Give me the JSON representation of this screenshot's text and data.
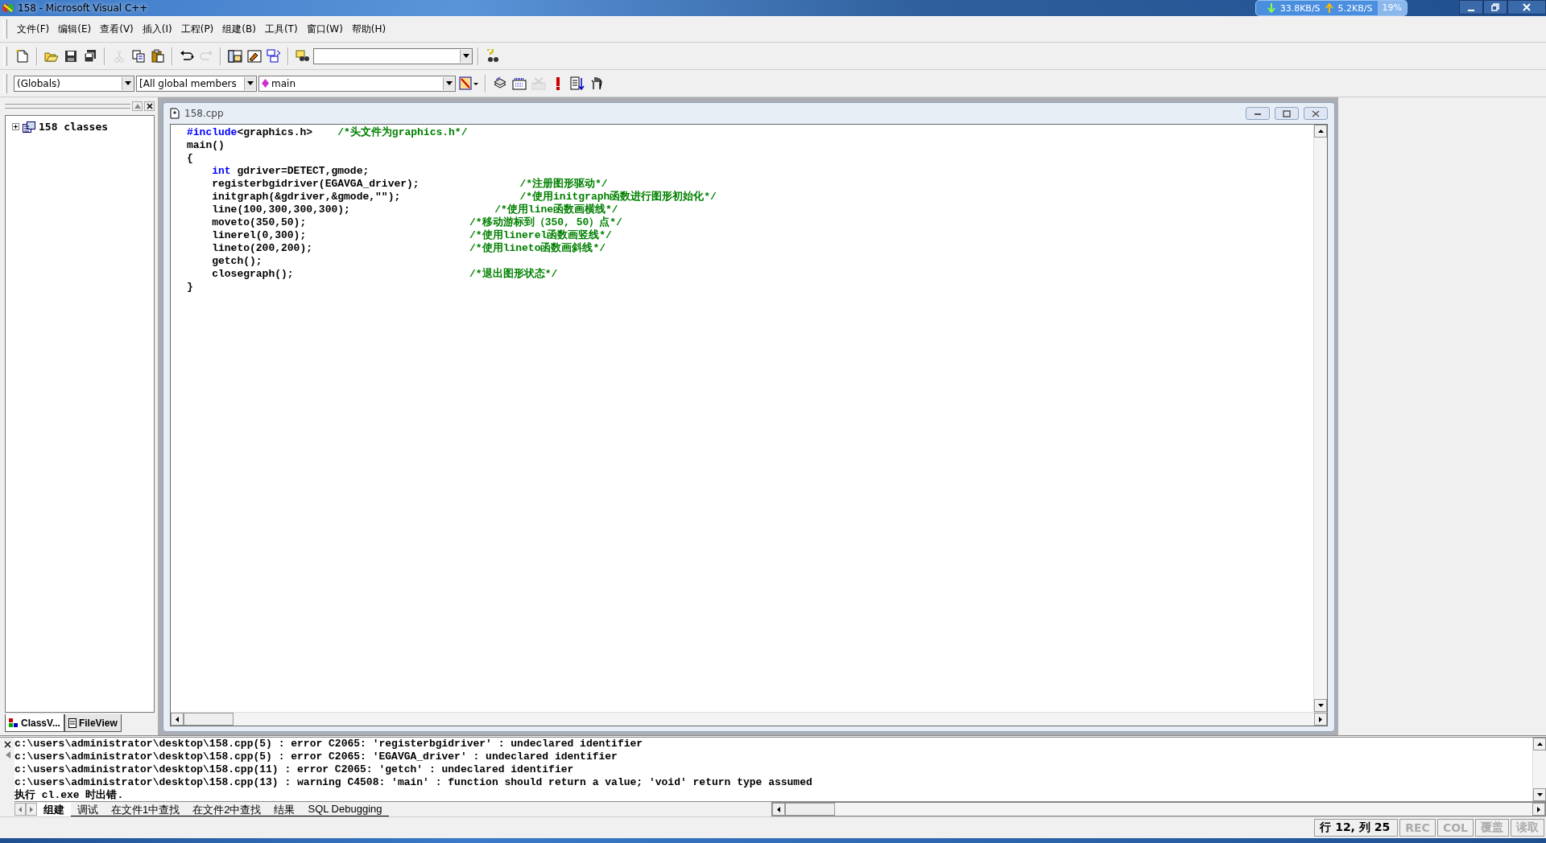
{
  "window": {
    "title": "158 - Microsoft Visual C++"
  },
  "net_meter": {
    "download": "33.8KB/S",
    "upload": "5.2KB/S",
    "cpu": "19%"
  },
  "menu": [
    "文件(F)",
    "编辑(E)",
    "查看(V)",
    "插入(I)",
    "工程(P)",
    "组建(B)",
    "工具(T)",
    "窗口(W)",
    "帮助(H)"
  ],
  "toolbar": [
    {
      "kind": "new",
      "disabled": false
    },
    {
      "kind": "sep"
    },
    {
      "kind": "open",
      "disabled": false
    },
    {
      "kind": "save",
      "disabled": false
    },
    {
      "kind": "saveall",
      "disabled": false
    },
    {
      "kind": "sep"
    },
    {
      "kind": "cut",
      "disabled": true
    },
    {
      "kind": "copy",
      "disabled": false
    },
    {
      "kind": "paste",
      "disabled": false
    },
    {
      "kind": "sep"
    },
    {
      "kind": "undo",
      "disabled": false
    },
    {
      "kind": "redo",
      "disabled": true
    },
    {
      "kind": "sep"
    },
    {
      "kind": "workspace",
      "disabled": false
    },
    {
      "kind": "output",
      "disabled": false
    },
    {
      "kind": "windows",
      "disabled": false
    },
    {
      "kind": "sep"
    },
    {
      "kind": "findfiles",
      "disabled": false
    },
    {
      "kind": "combo"
    },
    {
      "kind": "sep"
    },
    {
      "kind": "search",
      "disabled": false
    }
  ],
  "wizard_bar": {
    "scope": "(Globals)",
    "filter": "[All global members",
    "member": "main"
  },
  "build_toolbar": [
    {
      "kind": "compile",
      "disabled": false
    },
    {
      "kind": "build",
      "disabled": false
    },
    {
      "kind": "stop",
      "disabled": true
    },
    {
      "kind": "execute",
      "disabled": false
    },
    {
      "kind": "step",
      "disabled": false
    },
    {
      "kind": "breakpoint",
      "disabled": false
    }
  ],
  "workspace": {
    "tree": [
      {
        "label": "158 classes",
        "expanded": false
      }
    ],
    "tabs": [
      {
        "label": "ClassV...",
        "selected": true
      },
      {
        "label": "FileView",
        "selected": false
      }
    ]
  },
  "editor": {
    "title": "158.cpp",
    "lines": [
      {
        "indented": false,
        "segments": [
          {
            "kind": "keyword",
            "text": "#include"
          },
          {
            "kind": "code",
            "text": "<graphics.h>    "
          },
          {
            "kind": "comment",
            "text": "/*头文件为graphics.h*/"
          }
        ]
      },
      {
        "indented": false,
        "segments": [
          {
            "kind": "code",
            "text": "main()"
          }
        ]
      },
      {
        "indented": false,
        "segments": [
          {
            "kind": "code",
            "text": "{"
          }
        ]
      },
      {
        "indented": true,
        "segments": [
          {
            "kind": "keyword",
            "text": "int"
          },
          {
            "kind": "code",
            "text": " gdriver=DETECT,gmode;"
          }
        ]
      },
      {
        "indented": true,
        "segments": [
          {
            "kind": "code",
            "text": "registerbgidriver(EGAVGA_driver);                "
          },
          {
            "kind": "comment",
            "text": "/*注册图形驱动*/"
          }
        ]
      },
      {
        "indented": true,
        "segments": [
          {
            "kind": "code",
            "text": "initgraph(&gdriver,&gmode,\"\");                   "
          },
          {
            "kind": "comment",
            "text": "/*使用initgraph函数进行图形初始化*/"
          }
        ]
      },
      {
        "indented": true,
        "segments": [
          {
            "kind": "code",
            "text": "line(100,300,300,300);                       "
          },
          {
            "kind": "comment",
            "text": "/*使用line函数画横线*/"
          }
        ]
      },
      {
        "indented": true,
        "segments": [
          {
            "kind": "code",
            "text": "moveto(350,50);                          "
          },
          {
            "kind": "comment",
            "text": "/*移动游标到（350, 50）点*/"
          }
        ]
      },
      {
        "indented": true,
        "segments": [
          {
            "kind": "code",
            "text": "linerel(0,300);                          "
          },
          {
            "kind": "comment",
            "text": "/*使用linerel函数画竖线*/"
          }
        ]
      },
      {
        "indented": true,
        "segments": [
          {
            "kind": "code",
            "text": "lineto(200,200);                         "
          },
          {
            "kind": "comment",
            "text": "/*使用lineto函数画斜线*/"
          }
        ]
      },
      {
        "indented": true,
        "segments": [
          {
            "kind": "code",
            "text": "getch();"
          }
        ]
      },
      {
        "indented": true,
        "segments": [
          {
            "kind": "code",
            "text": "closegraph();                            "
          },
          {
            "kind": "comment",
            "text": "/*退出图形状态*/"
          }
        ]
      },
      {
        "indented": false,
        "segments": [
          {
            "kind": "code",
            "text": "}"
          }
        ]
      }
    ]
  },
  "output": {
    "lines": [
      "c:\\users\\administrator\\desktop\\158.cpp(5) : error C2065: 'registerbgidriver' : undeclared identifier",
      "c:\\users\\administrator\\desktop\\158.cpp(5) : error C2065: 'EGAVGA_driver' : undeclared identifier",
      "c:\\users\\administrator\\desktop\\158.cpp(11) : error C2065: 'getch' : undeclared identifier",
      "c:\\users\\administrator\\desktop\\158.cpp(13) : warning C4508: 'main' : function should return a value; 'void' return type assumed",
      "执行 cl.exe 时出错."
    ],
    "tabs": [
      {
        "label": "组建",
        "selected": true
      },
      {
        "label": "调试",
        "selected": false
      },
      {
        "label": "在文件1中查找",
        "selected": false
      },
      {
        "label": "在文件2中查找",
        "selected": false
      },
      {
        "label": "结果",
        "selected": false
      },
      {
        "label": "SQL Debugging",
        "selected": false
      }
    ]
  },
  "status_bar": {
    "position": "行 12, 列 25",
    "indicators": [
      {
        "label": "REC",
        "active": false
      },
      {
        "label": "COL",
        "active": false
      },
      {
        "label": "覆盖",
        "active": false
      },
      {
        "label": "读取",
        "active": false
      }
    ]
  }
}
